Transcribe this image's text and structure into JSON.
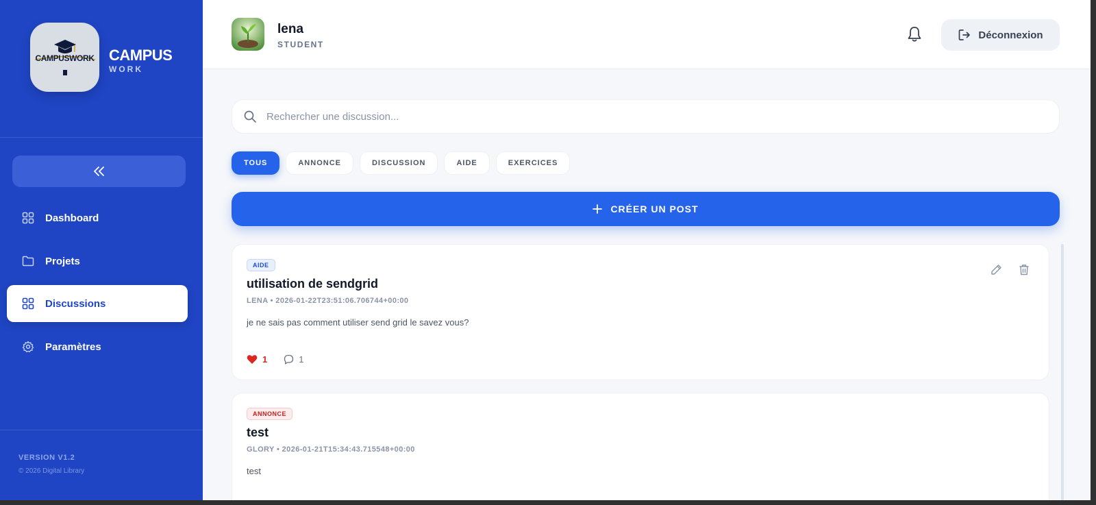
{
  "brand": {
    "name_main": "CAMPUS",
    "name_sub": "WORK",
    "logo_text": "CAMPUSWORK"
  },
  "sidebar": {
    "items": [
      {
        "label": "Dashboard",
        "icon": "grid-icon",
        "active": false
      },
      {
        "label": "Projets",
        "icon": "folder-icon",
        "active": false
      },
      {
        "label": "Discussions",
        "icon": "grid-icon",
        "active": true
      },
      {
        "label": "Paramètres",
        "icon": "gear-icon",
        "active": false
      }
    ],
    "version": "VERSION V1.2",
    "copyright": "© 2026 Digital Library"
  },
  "header": {
    "user_name": "lena",
    "user_role": "STUDENT",
    "logout_label": "Déconnexion"
  },
  "search": {
    "placeholder": "Rechercher une discussion..."
  },
  "filters": [
    "TOUS",
    "ANNONCE",
    "DISCUSSION",
    "AIDE",
    "EXERCICES"
  ],
  "active_filter": "TOUS",
  "create_label": "CRÉER UN POST",
  "posts": [
    {
      "category": "AIDE",
      "title": "utilisation de sendgrid",
      "meta": "LENA • 2026-01-22T23:51:06.706744+00:00",
      "body": "je ne sais pas comment utiliser send grid le savez vous?",
      "likes": "1",
      "comments": "1"
    },
    {
      "category": "ANNONCE",
      "title": "test",
      "meta": "GLORY • 2026-01-21T15:34:43.715548+00:00",
      "body": "test"
    }
  ],
  "colors": {
    "sidebar": "#1f45c4",
    "accent": "#2563eb",
    "like": "#dc2626",
    "annonce": "#c81e1e"
  }
}
